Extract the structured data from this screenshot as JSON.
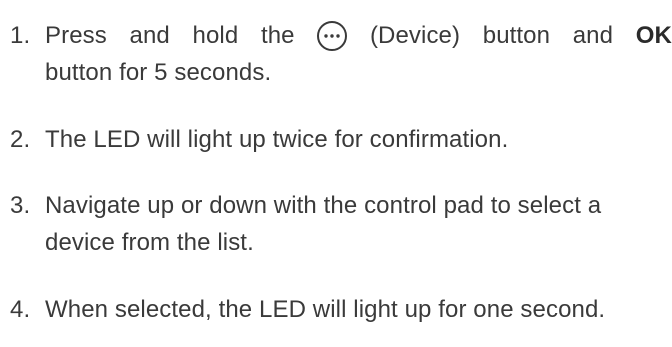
{
  "steps": [
    {
      "number": "1.",
      "line1_parts": [
        "Press",
        "and",
        "hold",
        "the"
      ],
      "device_label": "(Device)",
      "after_device_parts": [
        "button",
        "and"
      ],
      "bold_word": "OK",
      "line2": "button for 5 seconds."
    },
    {
      "number": "2.",
      "text": "The LED will light up twice for confirmation."
    },
    {
      "number": "3.",
      "line1": "Navigate up or down with the control pad to select a",
      "line2": "device from the list."
    },
    {
      "number": "4.",
      "text": "When selected, the LED will light up for one second."
    }
  ],
  "icons": {
    "device_button": "ellipsis-circle-icon"
  },
  "colors": {
    "text": "#3a3a3a"
  }
}
